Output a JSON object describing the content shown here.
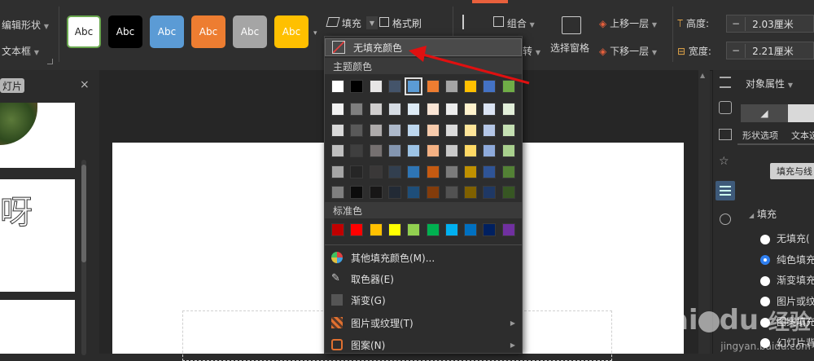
{
  "ribbon": {
    "edit_shape": "编辑形状",
    "textbox": "文本框",
    "styles": [
      {
        "label": "Abc",
        "bg": "#ffffff",
        "fg": "#222222",
        "border": "#6aa84f"
      },
      {
        "label": "Abc",
        "bg": "#000000",
        "fg": "#ffffff",
        "border": "#000000"
      },
      {
        "label": "Abc",
        "bg": "#5b9bd5",
        "fg": "#ffffff",
        "border": "#5b9bd5"
      },
      {
        "label": "Abc",
        "bg": "#ed7d31",
        "fg": "#ffffff",
        "border": "#ed7d31"
      },
      {
        "label": "Abc",
        "bg": "#a5a5a5",
        "fg": "#ffffff",
        "border": "#a5a5a5"
      },
      {
        "label": "Abc",
        "bg": "#ffc000",
        "fg": "#ffffff",
        "border": "#ffc000"
      }
    ],
    "fill": "填充",
    "format_painter": "格式刷",
    "group": "组合",
    "rotate": "转",
    "selection_pane": "选择窗格",
    "bring_forward": "上移一层",
    "send_backward": "下移一层",
    "height_label": "高度:",
    "height_value": "2.03厘米",
    "width_label": "宽度:",
    "width_value": "2.21厘米",
    "minus": "−",
    "accent": "#e8603c"
  },
  "left_panel": {
    "tab": "灯片",
    "close": "×",
    "thumb_text": "呀"
  },
  "right_panel": {
    "title": "对象属性",
    "tab1": "形状选项",
    "tab2": "文本选",
    "fill_button": "填充与线",
    "section": "填充",
    "options": [
      {
        "label": "无填充(",
        "selected": false
      },
      {
        "label": "纯色填充",
        "selected": true
      },
      {
        "label": "渐变填充",
        "selected": false
      },
      {
        "label": "图片或纹",
        "selected": false
      },
      {
        "label": "图案填充",
        "selected": false
      },
      {
        "label": "幻灯片背",
        "selected": false
      }
    ]
  },
  "dropdown": {
    "no_fill": "无填充颜色",
    "theme_colors": "主题颜色",
    "standard_colors": "标准色",
    "theme_top": [
      "#ffffff",
      "#000000",
      "#e7e6e6",
      "#44546a",
      "#5b9bd5",
      "#ed7d31",
      "#a5a5a5",
      "#ffc000",
      "#4472c4",
      "#70ad47"
    ],
    "theme_shades": [
      [
        "#f2f2f2",
        "#7f7f7f",
        "#d0cece",
        "#d6dce4",
        "#deebf6",
        "#fbe5d5",
        "#ededed",
        "#fff2cc",
        "#dae3f3",
        "#e2efd9"
      ],
      [
        "#d8d8d8",
        "#595959",
        "#aeabab",
        "#adb9ca",
        "#bdd7ee",
        "#f7cbac",
        "#dbdbdb",
        "#fee599",
        "#b4c6e7",
        "#c5e0b3"
      ],
      [
        "#bfbfbf",
        "#3f3f3f",
        "#757070",
        "#8496b0",
        "#9cc3e5",
        "#f4b183",
        "#c9c9c9",
        "#ffd965",
        "#8eaadb",
        "#a8d08d"
      ],
      [
        "#a5a5a5",
        "#262626",
        "#3a3838",
        "#323f4f",
        "#2e75b5",
        "#c55a11",
        "#7b7b7b",
        "#bf9000",
        "#2f5496",
        "#538135"
      ],
      [
        "#7f7f7f",
        "#0c0c0c",
        "#171616",
        "#222a35",
        "#1e4e79",
        "#833c0b",
        "#525252",
        "#7f6000",
        "#1f3864",
        "#375623"
      ]
    ],
    "standard": [
      "#c00000",
      "#ff0000",
      "#ffc000",
      "#ffff00",
      "#92d050",
      "#00b050",
      "#00b0f0",
      "#0070c0",
      "#002060",
      "#7030a0"
    ],
    "more_colors": "其他填充颜色(M)...",
    "eyedropper": "取色器(E)",
    "gradient": "渐变(G)",
    "picture_texture": "图片或纹理(T)",
    "pattern": "图案(N)"
  },
  "watermark": {
    "brand": "Bai",
    "brand2": "du",
    "site": "经验",
    "url": "jingyan.baidu.com"
  }
}
